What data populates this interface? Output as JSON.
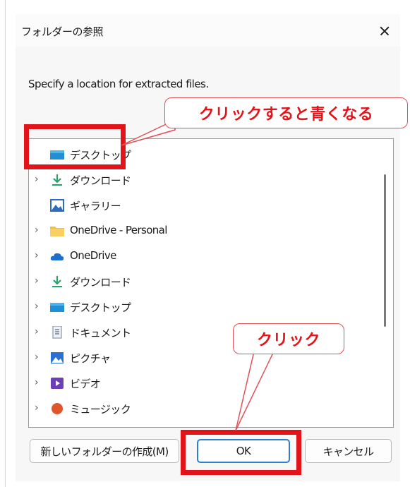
{
  "window": {
    "title": "フォルダーの参照"
  },
  "dialog": {
    "description": "Specify a location for extracted files."
  },
  "tree": {
    "items": [
      {
        "label": "デスクトップ",
        "icon": "desktop-folder-icon",
        "chevron": "",
        "selected": true
      },
      {
        "label": "ダウンロード",
        "icon": "download-arrow-icon",
        "chevron": "›"
      },
      {
        "label": "ギャラリー",
        "icon": "gallery-icon",
        "chevron": ""
      },
      {
        "label": "OneDrive - Personal",
        "icon": "folder-icon",
        "chevron": "›"
      },
      {
        "label": "OneDrive",
        "icon": "cloud-icon",
        "chevron": "›"
      },
      {
        "label": "ダウンロード",
        "icon": "download-arrow-icon",
        "chevron": "›"
      },
      {
        "label": "デスクトップ",
        "icon": "desktop-folder-icon",
        "chevron": "›"
      },
      {
        "label": "ドキュメント",
        "icon": "document-icon",
        "chevron": "›"
      },
      {
        "label": "ピクチャ",
        "icon": "pictures-icon",
        "chevron": "›"
      },
      {
        "label": "ビデオ",
        "icon": "video-icon",
        "chevron": "›"
      },
      {
        "label": "ミュージック",
        "icon": "music-icon",
        "chevron": "›"
      }
    ]
  },
  "buttons": {
    "new_folder": "新しいフォルダーの作成(M)",
    "ok": "OK",
    "cancel": "キャンセル"
  },
  "annotations": {
    "callout_select": "クリックすると青くなる",
    "callout_click": "クリック",
    "highlight_color": "#e2141a"
  }
}
